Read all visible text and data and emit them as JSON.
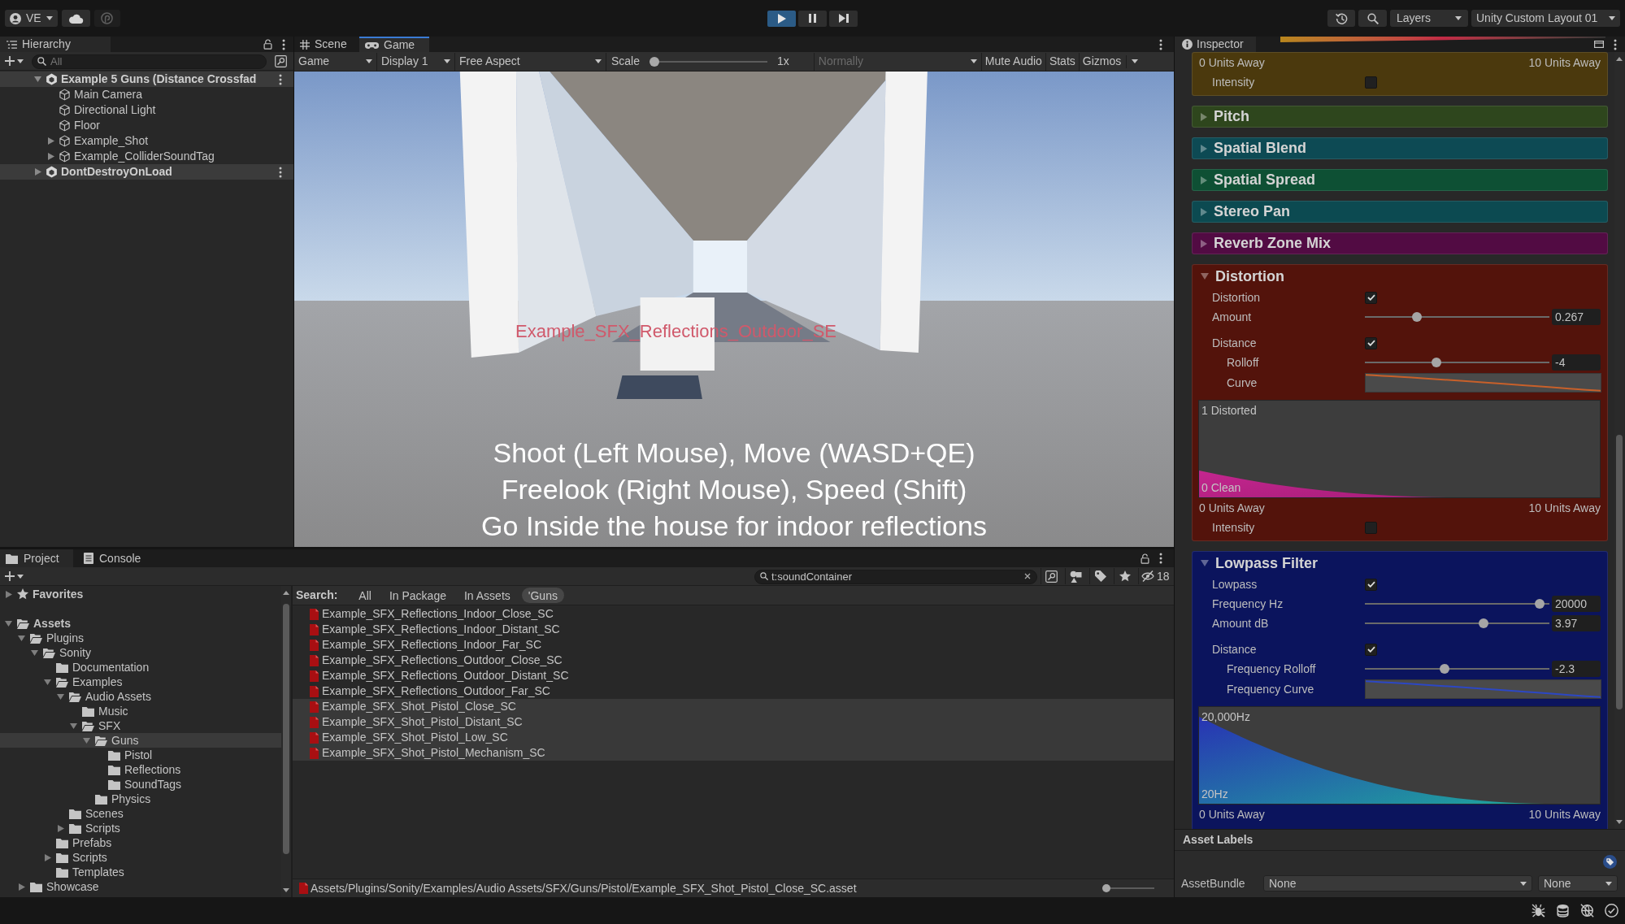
{
  "toolbar": {
    "account": "VE",
    "play_controls": [
      {
        "kind": "play",
        "on": true
      },
      {
        "kind": "pause",
        "on": false
      },
      {
        "kind": "step",
        "on": false
      }
    ],
    "layers": "Layers",
    "layout": "Unity Custom Layout 01"
  },
  "hierarchy": {
    "title": "Hierarchy",
    "search_placeholder": "All",
    "items": [
      {
        "label": "Example 5 Guns (Distance Crossfad",
        "kind": "scene",
        "expanded": true,
        "children": [
          {
            "label": "Main Camera",
            "kind": "object"
          },
          {
            "label": "Directional Light",
            "kind": "object"
          },
          {
            "label": "Floor",
            "kind": "object"
          },
          {
            "label": "Example_Shot",
            "kind": "object",
            "expanded": false
          },
          {
            "label": "Example_ColliderSoundTag",
            "kind": "object",
            "expanded": false
          }
        ]
      },
      {
        "label": "DontDestroyOnLoad",
        "kind": "scene",
        "expanded": false
      }
    ]
  },
  "game": {
    "tabs": [
      {
        "label": "Scene",
        "kind": "scene",
        "selected": false
      },
      {
        "label": "Game",
        "kind": "game",
        "selected": true
      }
    ],
    "toolbar": [
      {
        "kind": "dropdown",
        "label": "Game",
        "disabled": false
      },
      {
        "kind": "dropdown",
        "label": "Display 1",
        "disabled": false
      },
      {
        "kind": "dropdown",
        "label": "Free Aspect",
        "disabled": false
      },
      {
        "kind": "slider",
        "label": "Scale",
        "level": 0,
        "value": "1x",
        "disabled": false
      },
      {
        "kind": "dropdown",
        "label": "Normally",
        "disabled": true
      },
      {
        "kind": "button",
        "label": "Mute Audio",
        "disabled": false
      },
      {
        "kind": "button",
        "label": "Stats",
        "disabled": false
      },
      {
        "kind": "split",
        "label": "Gizmos",
        "disabled": false
      }
    ],
    "world_label": "Example_SFX_Reflections_Outdoor_SE",
    "instructions": [
      "Shoot (Left Mouse), Move (WASD+QE)",
      "Freelook (Right Mouse), Speed (Shift)",
      "Go Inside the house for indoor reflections"
    ]
  },
  "project": {
    "tabs": [
      {
        "label": "Project",
        "kind": "project",
        "selected": true
      },
      {
        "label": "Console",
        "kind": "console",
        "selected": false
      }
    ],
    "search_value": "t:soundContainer",
    "hidden_count": "18",
    "search_label": "Search:",
    "scopes": [
      {
        "label": "All",
        "selected": false
      },
      {
        "label": "In Package",
        "selected": false
      },
      {
        "label": "In Assets",
        "selected": false
      },
      {
        "label": "'Guns",
        "selected": true
      }
    ],
    "folders": [
      {
        "label": "Favorites",
        "kind": "favorites",
        "expanded": false,
        "selected": false
      },
      {
        "label": "Assets",
        "kind": "folder",
        "expanded": true,
        "selected": false,
        "children": [
          {
            "label": "Plugins",
            "kind": "folder",
            "expanded": true,
            "selected": false,
            "children": [
              {
                "label": "Sonity",
                "kind": "folder",
                "expanded": true,
                "selected": false,
                "children": [
                  {
                    "label": "Documentation",
                    "kind": "folder",
                    "selected": false
                  },
                  {
                    "label": "Examples",
                    "kind": "folder",
                    "expanded": true,
                    "selected": false,
                    "children": [
                      {
                        "label": "Audio Assets",
                        "kind": "folder",
                        "expanded": true,
                        "selected": false,
                        "children": [
                          {
                            "label": "Music",
                            "kind": "folder",
                            "selected": false
                          },
                          {
                            "label": "SFX",
                            "kind": "folder",
                            "expanded": true,
                            "selected": false,
                            "children": [
                              {
                                "label": "Guns",
                                "kind": "folder",
                                "expanded": true,
                                "selected": true,
                                "children": [
                                  {
                                    "label": "Pistol",
                                    "kind": "folder",
                                    "selected": false
                                  },
                                  {
                                    "label": "Reflections",
                                    "kind": "folder",
                                    "selected": false
                                  },
                                  {
                                    "label": "SoundTags",
                                    "kind": "folder",
                                    "selected": false
                                  }
                                ]
                              },
                              {
                                "label": "Physics",
                                "kind": "folder",
                                "selected": false
                              }
                            ]
                          }
                        ]
                      },
                      {
                        "label": "Scenes",
                        "kind": "folder",
                        "selected": false
                      },
                      {
                        "label": "Scripts",
                        "kind": "folder",
                        "expanded": false,
                        "selected": false
                      }
                    ]
                  },
                  {
                    "label": "Prefabs",
                    "kind": "folder",
                    "selected": false
                  },
                  {
                    "label": "Scripts",
                    "kind": "folder",
                    "expanded": false,
                    "selected": false
                  },
                  {
                    "label": "Templates",
                    "kind": "folder",
                    "selected": false
                  }
                ]
              }
            ]
          },
          {
            "label": "Showcase",
            "kind": "folder",
            "expanded": false,
            "selected": false
          }
        ]
      }
    ],
    "files": [
      {
        "name": "Example_SFX_Reflections_Indoor_Close_SC",
        "selected": false
      },
      {
        "name": "Example_SFX_Reflections_Indoor_Distant_SC",
        "selected": false
      },
      {
        "name": "Example_SFX_Reflections_Indoor_Far_SC",
        "selected": false
      },
      {
        "name": "Example_SFX_Reflections_Outdoor_Close_SC",
        "selected": false
      },
      {
        "name": "Example_SFX_Reflections_Outdoor_Distant_SC",
        "selected": false
      },
      {
        "name": "Example_SFX_Reflections_Outdoor_Far_SC",
        "selected": false
      },
      {
        "name": "Example_SFX_Shot_Pistol_Close_SC",
        "selected": true
      },
      {
        "name": "Example_SFX_Shot_Pistol_Distant_SC",
        "selected": true
      },
      {
        "name": "Example_SFX_Shot_Pistol_Low_SC",
        "selected": true
      },
      {
        "name": "Example_SFX_Shot_Pistol_Mechanism_SC",
        "selected": true
      }
    ],
    "path": "Assets/Plugins/Sonity/Examples/Audio Assets/SFX/Guns/Pistol/Example_SFX_Shot_Pistol_Close_SC.asset",
    "size_slider": {
      "level": 0
    }
  },
  "inspector": {
    "title": "Inspector",
    "sections": [
      {
        "color": "#4b390d",
        "rows": [
          {
            "kind": "units",
            "left": "0 Units Away",
            "right": "10 Units Away"
          },
          {
            "kind": "checkbox",
            "label": "Intensity",
            "checked": false
          }
        ]
      },
      {
        "title": "Pitch",
        "color": "#2e461d",
        "expanded": false
      },
      {
        "title": "Spatial Blend",
        "color": "#0d4a54",
        "expanded": false
      },
      {
        "title": "Spatial Spread",
        "color": "#0e5034",
        "expanded": false
      },
      {
        "title": "Stereo Pan",
        "color": "#0c4a51",
        "expanded": false
      },
      {
        "title": "Reverb Zone Mix",
        "color": "#520b43",
        "expanded": false
      },
      {
        "title": "Distortion",
        "color": "#53130b",
        "expanded": true,
        "rows": [
          {
            "kind": "checkbox",
            "label": "Distortion",
            "checked": true
          },
          {
            "kind": "slider",
            "label": "Amount",
            "level": 0.27,
            "value": "0.267"
          },
          {
            "kind": "checkbox",
            "label": "Distance",
            "checked": true,
            "children": [
              {
                "kind": "slider",
                "label": "Rolloff",
                "level": 0.38,
                "value": "-4"
              },
              {
                "kind": "curve",
                "label": "Curve",
                "color": "#c8602a"
              }
            ]
          },
          {
            "kind": "graph",
            "top": "1 Distorted",
            "bottom": "0 Clean"
          },
          {
            "kind": "units",
            "left": "0 Units Away",
            "right": "10 Units Away"
          },
          {
            "kind": "checkbox",
            "label": "Intensity",
            "checked": false
          }
        ]
      },
      {
        "title": "Lowpass Filter",
        "color": "#0b145d",
        "expanded": true,
        "rows": [
          {
            "kind": "checkbox",
            "label": "Lowpass",
            "checked": true
          },
          {
            "kind": "slider",
            "label": "Frequency Hz",
            "level": 0.97,
            "value": "20000"
          },
          {
            "kind": "slider",
            "label": "Amount dB",
            "level": 0.65,
            "value": "3.97"
          },
          {
            "kind": "checkbox",
            "label": "Distance",
            "checked": true,
            "children": [
              {
                "kind": "slider",
                "label": "Frequency Rolloff",
                "level": 0.43,
                "value": "-2.3"
              },
              {
                "kind": "curve",
                "label": "Frequency Curve",
                "color": "#2c47c4"
              }
            ]
          },
          {
            "kind": "graph",
            "top": "20,000Hz",
            "bottom": "20Hz"
          },
          {
            "kind": "units",
            "left": "0 Units Away",
            "right": "10 Units Away"
          }
        ]
      }
    ],
    "asset_labels": "Asset Labels",
    "asset_bundle": {
      "label": "AssetBundle",
      "value": "None",
      "variant": "None"
    }
  }
}
